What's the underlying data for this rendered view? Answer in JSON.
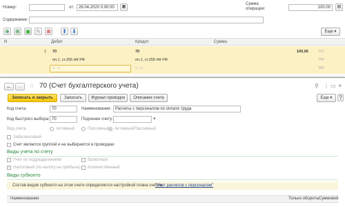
{
  "doc": {
    "number_label": "Номер:",
    "date_label": "от:",
    "date_value": "26.04.2020  0:00:00",
    "sum_label": "Сумма операции:",
    "sum_value": "100,00",
    "content_label": "Содержание:",
    "more_label": "Еще"
  },
  "table": {
    "headers": {
      "n": "N",
      "debit": "Дебет",
      "credit": "Кредит",
      "sum": "Сумма"
    },
    "row": {
      "n": "1",
      "debit_account": "70",
      "credit_account": "70",
      "debit_sub": "пп.1, ст.255 НК РФ",
      "credit_sub": "пп.1, ст.255 НК РФ",
      "debit_sub2": "<...>",
      "credit_sub2": "<...>",
      "sum": "100,00",
      "tags": [
        "НУ:",
        "ПР:",
        "ВР:"
      ]
    }
  },
  "dialog": {
    "title": "70 (Счет бухгалтерского учета)",
    "buttons": {
      "save_close": "Записать и закрыть",
      "save": "Записать",
      "journal": "Журнал проводок",
      "description": "Описание счета",
      "more": "Еще"
    },
    "code_label": "Код счета:",
    "code_value": "70",
    "name_label": "Наименование:",
    "name_value": "Расчеты с персоналом по оплате труда",
    "quick_label": "Код быстрого выбора:",
    "quick_value": "70",
    "subordinate_label": "Подчинен счету:",
    "type_label": "Вид счета",
    "type_options": [
      "Активный",
      "Пассивный",
      "Активный/Пассивный"
    ],
    "offbalance_label": "Забалансовый",
    "group_label": "Счет является группой и не выбирается в проводках",
    "accounting_types_header": "Виды учета по счету",
    "by_division": "Учет по подразделениям",
    "currency": "Валютный",
    "tax_profit": "Налоговый (по налогу на прибыль)",
    "quantity": "Количественный",
    "subconto_header": "Виды субконто",
    "subconto_note": "Состав видов субконто на этом счете определяется настройкой плана счетов",
    "subconto_link": "\"Учет расчетов с персоналом\"",
    "grid_headers": {
      "name": "Наименование",
      "turnover_only": "Только обороты",
      "total": "Суммовой"
    }
  }
}
